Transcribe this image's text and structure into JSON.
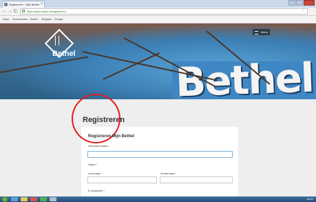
{
  "browser": {
    "tab_title": "Registreren - Mijn Bethel",
    "tab_close": "×",
    "url": "https://mijn.bethel.nl/registreren/",
    "nav_back": "←",
    "nav_forward": "→",
    "nav_reload": "C",
    "bookmarks": [
      "Apps",
      "Downloaden - Bethel",
      "Bloggen - Google"
    ]
  },
  "site": {
    "logo_text": "Bethel",
    "hero_word": "Bethel",
    "menu_label": "Menu"
  },
  "page": {
    "title": "Registreren"
  },
  "form": {
    "card_title": "Registreren Mijn Bethel",
    "username_label": "Gebruikersnaam",
    "name_label": "Naam",
    "firstname_label": "Voornaam",
    "lastname_label": "Achternaam",
    "email_label": "E-mailadres",
    "required_mark": "*"
  },
  "taskbar": {
    "clock": "16:52"
  },
  "colors": {
    "annotation_circle": "#e21b1b",
    "menu_button": "#2e3d45",
    "hero_blue": "#3f86c4"
  }
}
